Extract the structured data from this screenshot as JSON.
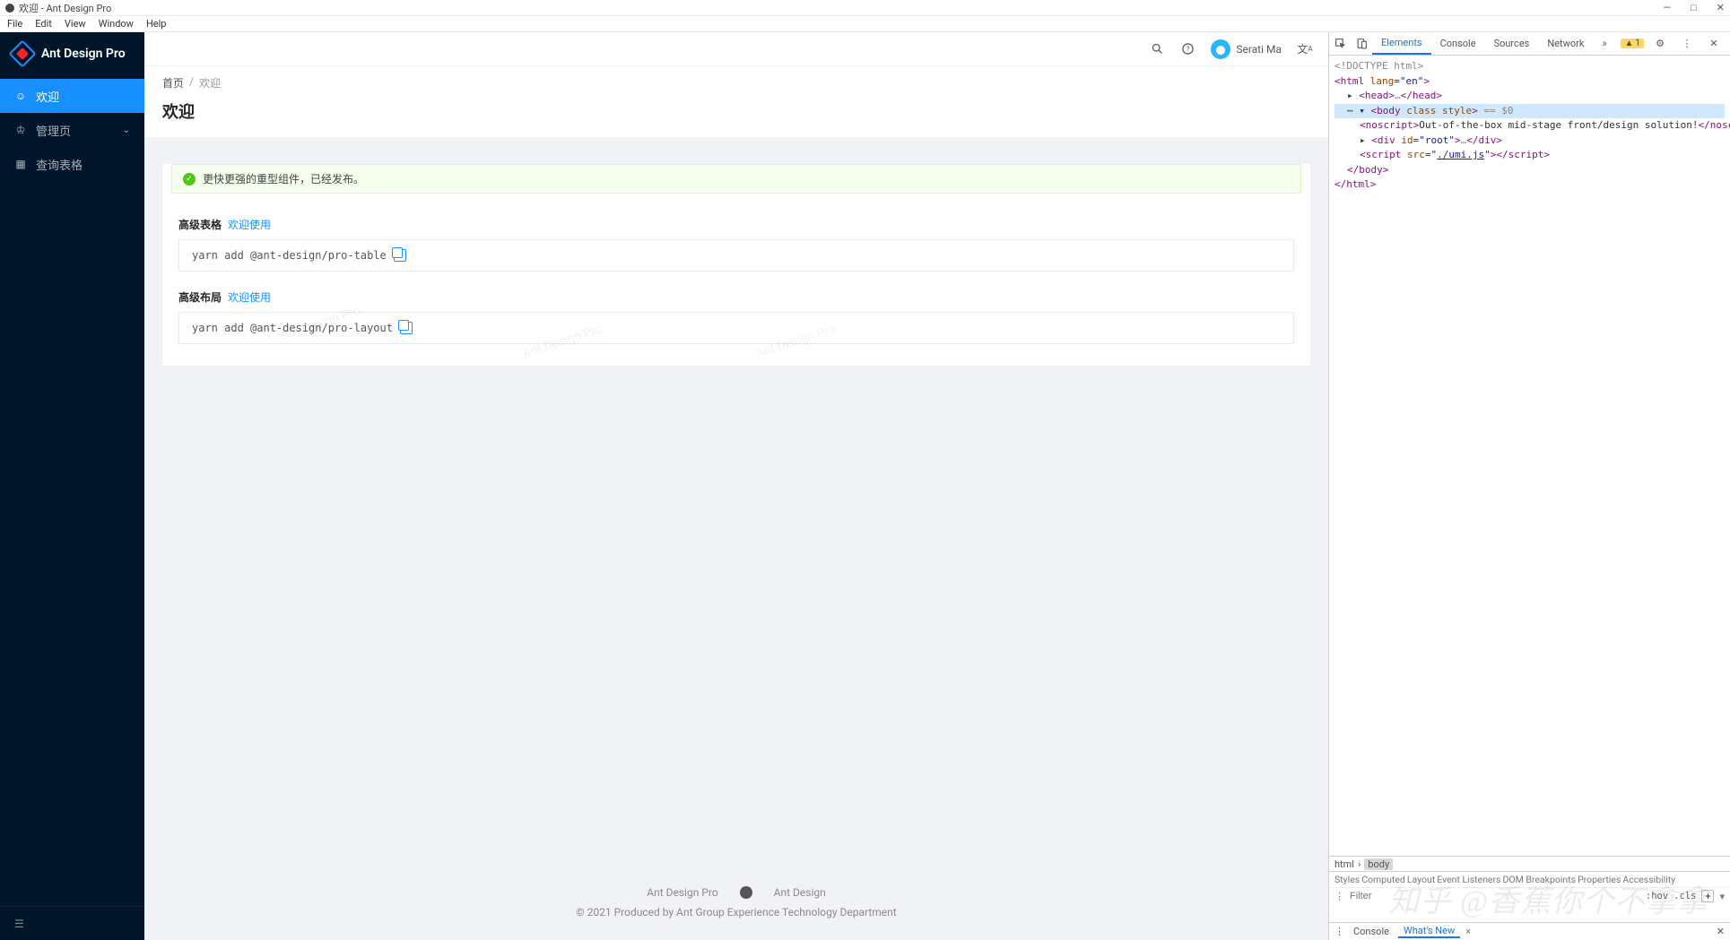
{
  "window": {
    "title": "欢迎 - Ant Design Pro",
    "menubar": [
      "File",
      "Edit",
      "View",
      "Window",
      "Help"
    ]
  },
  "sidebar": {
    "brand": "Ant Design Pro",
    "items": [
      {
        "key": "welcome",
        "label": "欢迎",
        "icon": "smile",
        "active": true
      },
      {
        "key": "admin",
        "label": "管理页",
        "icon": "crown",
        "expandable": true
      },
      {
        "key": "table",
        "label": "查询表格",
        "icon": "table"
      }
    ]
  },
  "topbar": {
    "username": "Serati Ma"
  },
  "breadcrumb": {
    "home": "首页",
    "sep": "/",
    "current": "欢迎"
  },
  "page_title": "欢迎",
  "alert_text": "更快更强的重型组件，已经发布。",
  "sections": [
    {
      "heading": "高级表格",
      "link_text": "欢迎使用",
      "code": "yarn add @ant-design/pro-table"
    },
    {
      "heading": "高级布局",
      "link_text": "欢迎使用",
      "code": "yarn add @ant-design/pro-layout"
    }
  ],
  "watermark_text": "Ant Design Pro",
  "footer": {
    "links": {
      "l1": "Ant Design Pro",
      "l2": "Ant Design"
    },
    "copyright": "© 2021 Produced by Ant Group Experience Technology Department"
  },
  "devtools": {
    "tabs": [
      "Elements",
      "Console",
      "Sources",
      "Network"
    ],
    "active_tab": "Elements",
    "warning_count": "1",
    "dom_lines": {
      "doctype": "<!DOCTYPE html>",
      "html_open": "<html lang=\"en\">",
      "head": "<head>…</head>",
      "body_open_pre": "<body class style>",
      "body_eq": " == $0",
      "noscript": "Out-of-the-box mid-stage front/design solution!",
      "root_div": "<div id=\"root\">…</div>",
      "script_src": "./umi.js",
      "body_close": "</body>",
      "html_close": "</html>"
    },
    "crumb": [
      "html",
      "body"
    ],
    "styles_tabs": [
      "Styles",
      "Computed",
      "Layout",
      "Event Listeners",
      "DOM Breakpoints",
      "Properties",
      "Accessibility"
    ],
    "filter_placeholder": "Filter",
    "hov": ":hov",
    "cls": ".cls",
    "drawer_tabs": {
      "console": "Console",
      "whatsnew": "What's New"
    }
  },
  "zhihu_watermark": "知乎 @香蕉你个不拿拿"
}
